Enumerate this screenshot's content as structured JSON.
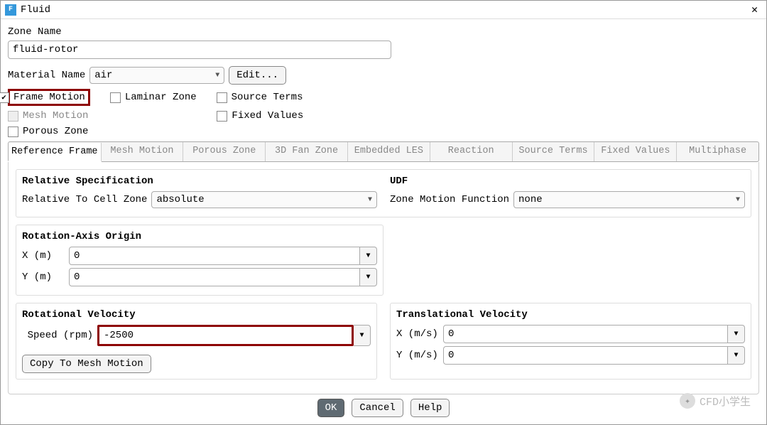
{
  "title": "Fluid",
  "zone_name_label": "Zone Name",
  "zone_name": "fluid-rotor",
  "material_name_label": "Material Name",
  "material": "air",
  "edit_btn": "Edit...",
  "checks": {
    "frame_motion": "Frame Motion",
    "laminar_zone": "Laminar Zone",
    "source_terms": "Source Terms",
    "mesh_motion": "Mesh Motion",
    "fixed_values": "Fixed Values",
    "porous_zone": "Porous Zone"
  },
  "tabs": {
    "reference_frame": "Reference Frame",
    "mesh_motion": "Mesh Motion",
    "porous_zone": "Porous Zone",
    "fan_zone": "3D Fan Zone",
    "embedded_les": "Embedded LES",
    "reaction": "Reaction",
    "source_terms": "Source Terms",
    "fixed_values": "Fixed Values",
    "multiphase": "Multiphase"
  },
  "relative_spec_title": "Relative Specification",
  "relative_label": "Relative To Cell Zone",
  "relative_value": "absolute",
  "udf_title": "UDF",
  "udf_label": "Zone Motion Function",
  "udf_value": "none",
  "rot_origin_title": "Rotation-Axis Origin",
  "x_m": "X (m)",
  "y_m": "Y (m)",
  "x_val": "0",
  "y_val": "0",
  "rot_vel_title": "Rotational Velocity",
  "speed_label": "Speed (rpm)",
  "speed_value": "-2500",
  "copy_btn": "Copy To Mesh Motion",
  "trans_vel_title": "Translational Velocity",
  "x_ms": "X (m/s)",
  "y_ms": "Y (m/s)",
  "tx_val": "0",
  "ty_val": "0",
  "ok": "OK",
  "cancel": "Cancel",
  "help": "Help",
  "watermark": "CFD小学生"
}
